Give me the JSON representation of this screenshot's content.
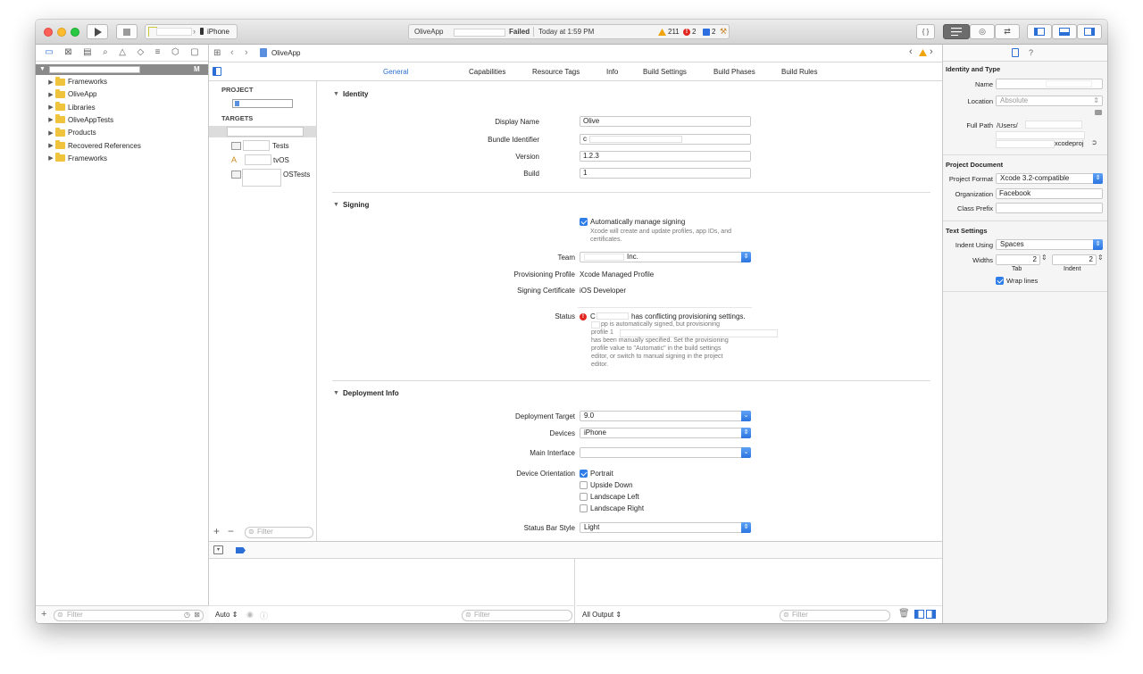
{
  "toolbar": {
    "scheme_device": "iPhone",
    "activity_app": "OliveApp",
    "activity_status": "Failed",
    "activity_time": "Today at 1:59 PM",
    "warnings_count": "211",
    "errors_count": "2",
    "issues_count": "2"
  },
  "jumpbar": {
    "project": "OliveApp"
  },
  "navigator": {
    "root_badge": "M",
    "items": [
      {
        "label": "Frameworks"
      },
      {
        "label": "OliveApp"
      },
      {
        "label": "Libraries"
      },
      {
        "label": "OliveAppTests"
      },
      {
        "label": "Products"
      },
      {
        "label": "Recovered References"
      },
      {
        "label": "Frameworks"
      }
    ],
    "filter_placeholder": "Filter"
  },
  "editor_tabs": [
    "General",
    "Capabilities",
    "Resource Tags",
    "Info",
    "Build Settings",
    "Build Phases",
    "Build Rules"
  ],
  "targets_pane": {
    "project_header": "PROJECT",
    "targets_header": "TARGETS",
    "targets": [
      {
        "label": ""
      },
      {
        "label": "Tests"
      },
      {
        "label": "tvOS"
      },
      {
        "label": "OSTests"
      }
    ],
    "filter_placeholder": "Filter"
  },
  "identity": {
    "title": "Identity",
    "display_name_label": "Display Name",
    "display_name": "Olive",
    "bundle_id_label": "Bundle Identifier",
    "bundle_id": "c",
    "version_label": "Version",
    "version": "1.2.3",
    "build_label": "Build",
    "build": "1"
  },
  "signing": {
    "title": "Signing",
    "auto_label": "Automatically manage signing",
    "auto_desc": [
      "Xcode will create and update profiles, app IDs, and",
      "certificates."
    ],
    "team_label": "Team",
    "team": "Inc.",
    "profile_label": "Provisioning Profile",
    "profile": "Xcode Managed Profile",
    "cert_label": "Signing Certificate",
    "cert": "iOS Developer",
    "status_label": "Status",
    "status_title": "has conflicting provisioning settings.",
    "status_lines": [
      "pp is automatically signed, but provisioning",
      "profile 1",
      "has been manually specified. Set the provisioning",
      "profile value to \"Automatic\" in the build settings",
      "editor, or switch to manual signing in the project",
      "editor."
    ]
  },
  "deployment": {
    "title": "Deployment Info",
    "target_label": "Deployment Target",
    "target": "9.0",
    "devices_label": "Devices",
    "devices": "iPhone",
    "main_label": "Main Interface",
    "main": "",
    "orientation_label": "Device Orientation",
    "orientations": [
      {
        "label": "Portrait",
        "checked": true
      },
      {
        "label": "Upside Down",
        "checked": false
      },
      {
        "label": "Landscape Left",
        "checked": false
      },
      {
        "label": "Landscape Right",
        "checked": false
      }
    ],
    "status_bar_label": "Status Bar Style",
    "status_bar": "Light"
  },
  "debug": {
    "auto_label": "Auto",
    "filter_placeholder": "Filter",
    "output_label": "All Output",
    "filter2_placeholder": "Filter"
  },
  "inspector": {
    "identity_header": "Identity and Type",
    "name_label": "Name",
    "location_label": "Location",
    "location": "Absolute",
    "full_path_label": "Full Path",
    "full_path": "/Users/",
    "full_path_end": "xcodeproj",
    "project_doc_header": "Project Document",
    "format_label": "Project Format",
    "format": "Xcode 3.2-compatible",
    "org_label": "Organization",
    "org": "Facebook",
    "class_prefix_label": "Class Prefix",
    "text_settings_header": "Text Settings",
    "indent_using_label": "Indent Using",
    "indent_using": "Spaces",
    "widths_label": "Widths",
    "tab_value": "2",
    "indent_value": "2",
    "tab_caption": "Tab",
    "indent_caption": "Indent",
    "wrap_label": "Wrap lines"
  },
  "colors": {
    "accent": "#2e7de9",
    "error": "#e0261f",
    "warning": "#f0a30a"
  }
}
